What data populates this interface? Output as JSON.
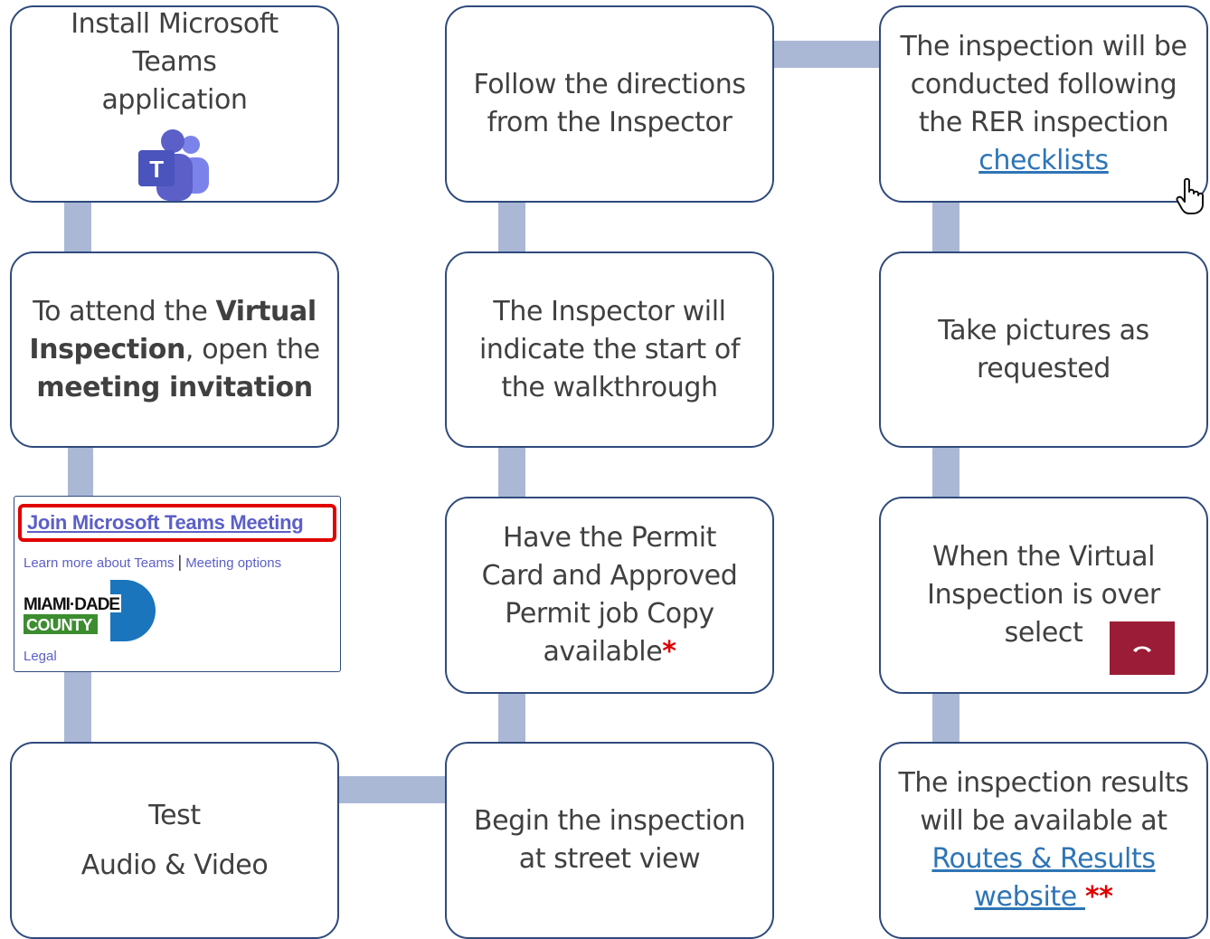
{
  "steps": {
    "install": {
      "text": "Install Microsoft Teams  application"
    },
    "attend": {
      "pre": "To attend the ",
      "bold1": "Virtual Inspection",
      "mid": ", open the ",
      "bold2": "meeting invitation"
    },
    "test": {
      "line1": "Test",
      "line2": "Audio & Video"
    },
    "follow": {
      "text": "Follow the directions from the Inspector"
    },
    "walkthrough": {
      "text": "The Inspector will indicate the start of the walkthrough"
    },
    "permit": {
      "text": "Have the Permit Card and Approved Permit job Copy available",
      "mark": "*"
    },
    "begin": {
      "text": "Begin the inspection at street view"
    },
    "conducted": {
      "text": "The inspection will be conducted following the RER inspection ",
      "link": "checklists"
    },
    "pictures": {
      "text": "Take pictures as requested"
    },
    "over": {
      "text": "When the Virtual Inspection is over select"
    },
    "results": {
      "text": "The inspection results will be available at  ",
      "link": "Routes & Results website ",
      "mark": "**"
    }
  },
  "invite": {
    "join_link": "Join Microsoft Teams Meeting",
    "learn_more": "Learn more about Teams",
    "separator": "|",
    "meeting_options": "Meeting options",
    "logo_text_top": "MIAMI·DADE",
    "logo_text_bottom": "COUNTY",
    "legal": "Legal"
  },
  "icons": {
    "teams": "microsoft-teams-icon",
    "hangup": "phone-hangup-icon",
    "cursor": "hand-pointer-icon"
  },
  "colors": {
    "box_border": "#2f4a7c",
    "connector": "#aab8d6",
    "link": "#2e75b6",
    "asterisk": "#e00000",
    "hangup_bg": "#9b1c37",
    "teams_purple": "#5b5fc7"
  }
}
